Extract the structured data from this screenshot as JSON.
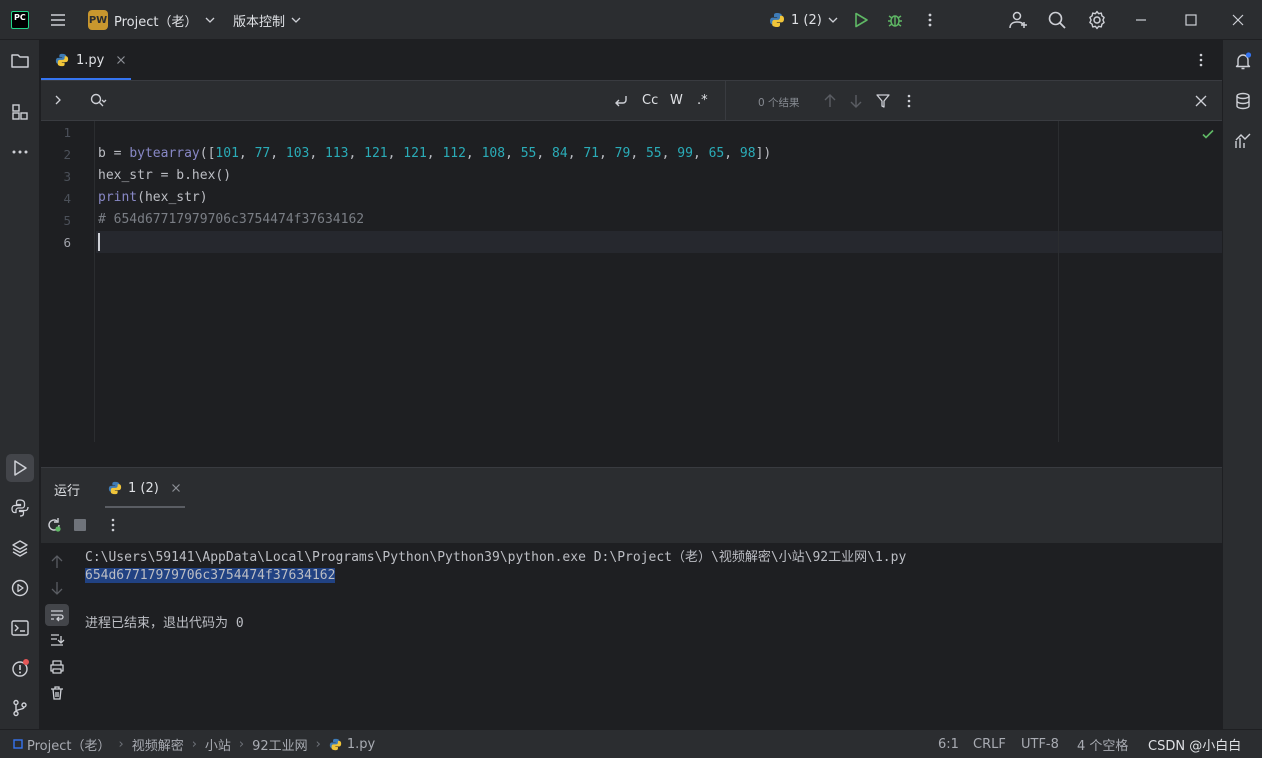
{
  "titlebar": {
    "logo": "PC",
    "project_badge": "PW",
    "project_name": "Project（老）",
    "vcs_label": "版本控制",
    "run_config": "1 (2)"
  },
  "editor_tab": {
    "filename": "1.py"
  },
  "findbar": {
    "match_case": "Cc",
    "words": "W",
    "regex": ".*",
    "result": "0 个结果"
  },
  "editor": {
    "line_numbers": [
      "1",
      "2",
      "3",
      "4",
      "5",
      "6"
    ],
    "line2": {
      "var": "b = ",
      "fn": "bytearray",
      "open": "([",
      "values": [
        "101",
        "77",
        "103",
        "113",
        "121",
        "121",
        "112",
        "108",
        "55",
        "84",
        "71",
        "79",
        "55",
        "99",
        "65",
        "98"
      ],
      "close": "])"
    },
    "line3": "hex_str = b.hex()",
    "line4_fn": "print",
    "line4_rest": "(hex_str)",
    "line5": "# 654d67717979706c3754474f37634162"
  },
  "run_panel": {
    "title": "运行",
    "tab_label": "1 (2)",
    "console": {
      "command": "C:\\Users\\59141\\AppData\\Local\\Programs\\Python\\Python39\\python.exe D:\\Project（老）\\视频解密\\小站\\92工业网\\1.py",
      "output": "654d67717979706c3754474f37634162",
      "exit": "进程已结束，退出代码为 0"
    }
  },
  "statusbar": {
    "breadcrumb": [
      "Project（老）",
      "视频解密",
      "小站",
      "92工业网",
      "1.py"
    ],
    "position": "6:1",
    "line_sep": "CRLF",
    "encoding": "UTF-8",
    "indent": "4 个空格",
    "watermark": "CSDN @小白白"
  },
  "colors": {
    "accent": "#3574f0",
    "run_green": "#5fb865",
    "number": "#2aacb8",
    "builtin": "#8888c6",
    "comment": "#7a7e85",
    "selection": "#214283"
  }
}
